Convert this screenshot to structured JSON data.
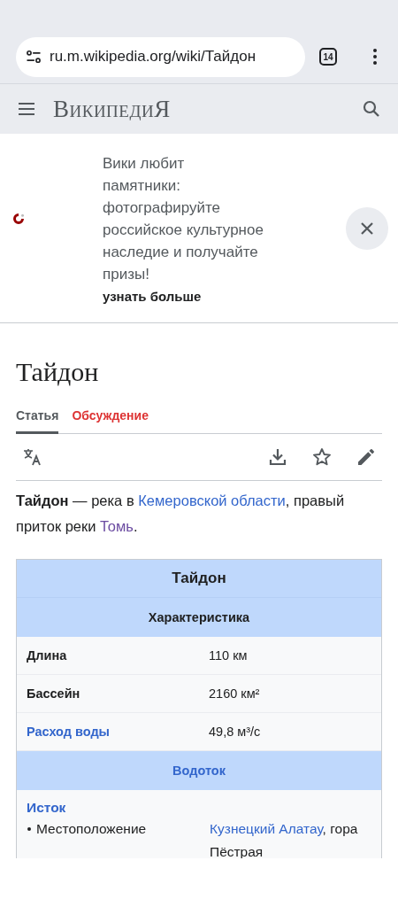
{
  "browser": {
    "url": "ru.m.wikipedia.org/wiki/Тайдон",
    "tab_count": "14"
  },
  "header": {
    "logo": "ВикипедиЯ"
  },
  "banner": {
    "message": "Вики любит памятники: фотографируйте российское культурное наследие и получайте призы!",
    "link": "узнать больше"
  },
  "article": {
    "title": "Тайдон",
    "tabs": [
      {
        "label": "Статья",
        "selected": true
      },
      {
        "label": "Обсуждение",
        "selected": false
      }
    ],
    "intro": [
      {
        "kind": "bold",
        "text": "Тайдон"
      },
      {
        "kind": "plain",
        "text": " — река в "
      },
      {
        "kind": "link",
        "text": "Кемеровской области"
      },
      {
        "kind": "plain",
        "text": ", правый приток реки "
      },
      {
        "kind": "visited_link",
        "text": "Томь"
      },
      {
        "kind": "plain",
        "text": "."
      }
    ]
  },
  "infobox": {
    "rows": [
      {
        "kind": "title",
        "text": "Тайдон"
      },
      {
        "kind": "header",
        "text": "Характеристика"
      },
      {
        "kind": "row",
        "label": "Длина",
        "label_link": false,
        "value": [
          {
            "kind": "plain",
            "text": "110 км"
          }
        ]
      },
      {
        "kind": "row",
        "label": "Бассейн",
        "label_link": false,
        "value": [
          {
            "kind": "plain",
            "text": "2160 км²"
          }
        ]
      },
      {
        "kind": "row",
        "label": "Расход воды",
        "label_link": true,
        "value": [
          {
            "kind": "plain",
            "text": "49,8 м³/с"
          }
        ]
      },
      {
        "kind": "section",
        "text": "Водоток"
      },
      {
        "kind": "subheader",
        "text": "Исток"
      },
      {
        "kind": "subrow",
        "label": "Местоположение",
        "value": [
          {
            "kind": "link",
            "text": "Кузнецкий Алатау"
          },
          {
            "kind": "plain",
            "text": ", гора Пёстрая"
          }
        ]
      }
    ]
  }
}
